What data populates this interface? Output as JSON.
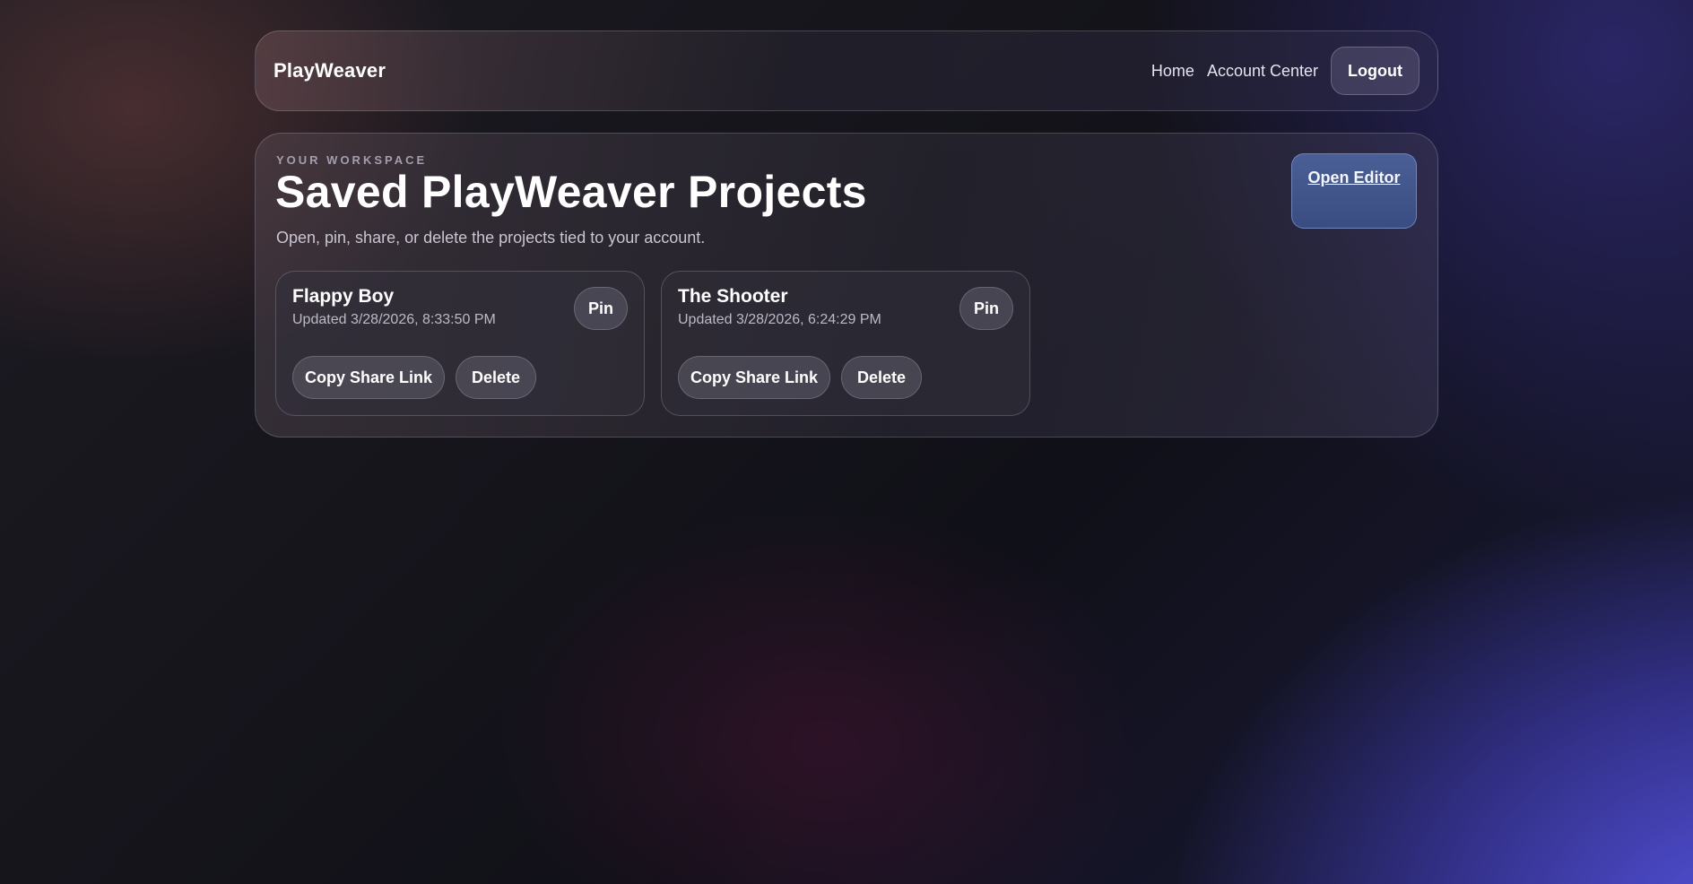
{
  "header": {
    "brand": "PlayWeaver",
    "nav": {
      "home": "Home",
      "account_center": "Account Center",
      "logout": "Logout"
    }
  },
  "main": {
    "eyebrow": "YOUR WORKSPACE",
    "title": "Saved PlayWeaver Projects",
    "subtitle": "Open, pin, share, or delete the projects tied to your account.",
    "open_editor": "Open Editor",
    "projects": [
      {
        "name": "Flappy Boy",
        "updated": "Updated 3/28/2026, 8:33:50 PM",
        "pin_label": "Pin",
        "share_label": "Copy Share Link",
        "delete_label": "Delete"
      },
      {
        "name": "The Shooter",
        "updated": "Updated 3/28/2026, 6:24:29 PM",
        "pin_label": "Pin",
        "share_label": "Copy Share Link",
        "delete_label": "Delete"
      }
    ]
  },
  "colors": {
    "accent_button": "#4a5f95",
    "background_glow": "#5856e6"
  }
}
